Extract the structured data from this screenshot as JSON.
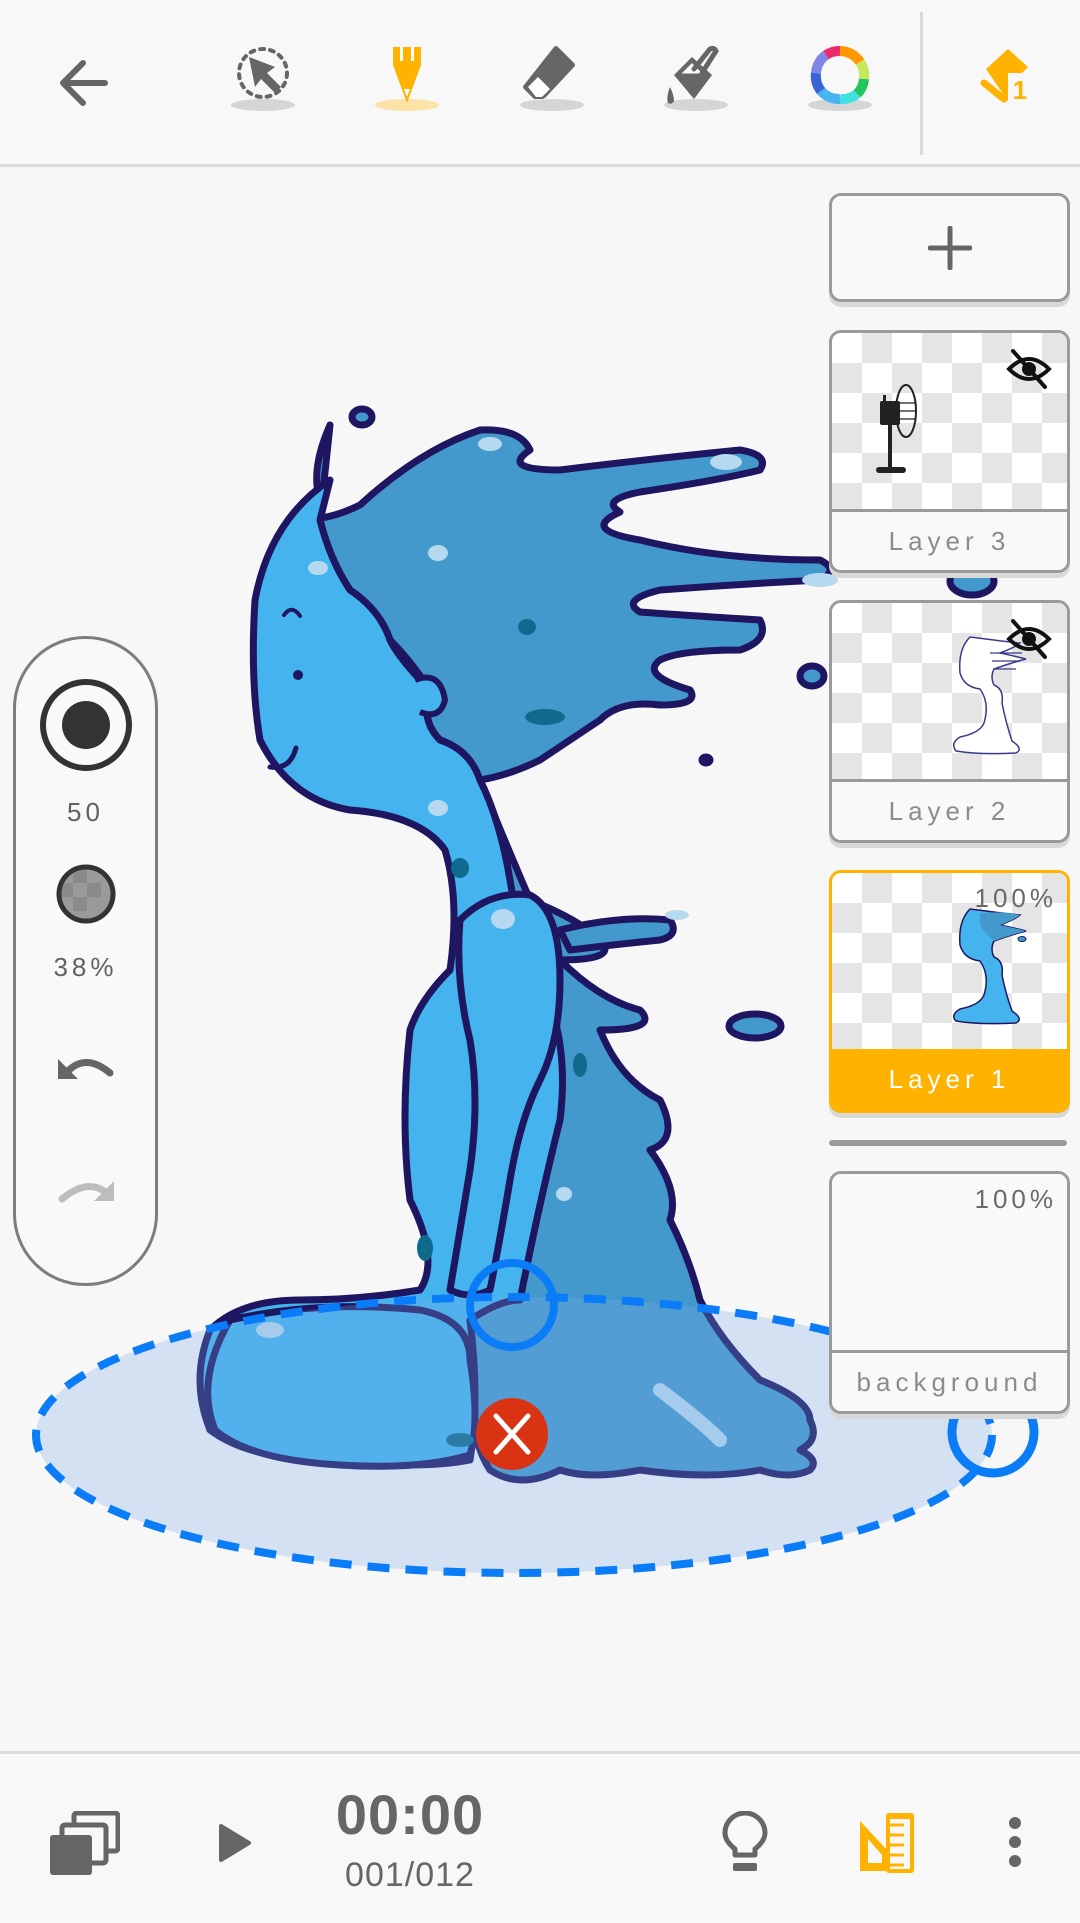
{
  "toolbar": {
    "back": {
      "icon": "arrow-left-icon"
    },
    "tools": [
      {
        "id": "select",
        "icon": "lasso-select-icon",
        "active": false
      },
      {
        "id": "pencil",
        "icon": "pencil-icon",
        "active": true
      },
      {
        "id": "eraser",
        "icon": "eraser-icon",
        "active": false
      },
      {
        "id": "fill",
        "icon": "paint-bucket-icon",
        "active": false
      },
      {
        "id": "color",
        "icon": "color-wheel-icon",
        "active": false
      }
    ],
    "layers_button": {
      "icon": "layers-icon",
      "badge": "1"
    }
  },
  "colors": {
    "accent": "#FFB300",
    "icon_gray": "#666666",
    "ruler_blue": "#0A7CF7",
    "delete_red": "#D93314",
    "figure_light": "#45B4EE",
    "figure_dark": "#4499CC",
    "outline": "#1E1660"
  },
  "side_panel": {
    "brush_size": "50",
    "opacity": "38%",
    "undo": {
      "icon": "undo-icon",
      "enabled": true
    },
    "redo": {
      "icon": "redo-icon",
      "enabled": false
    }
  },
  "layers": {
    "add_label": "+",
    "items": [
      {
        "name": "Layer 3",
        "hidden": true,
        "opacity": "",
        "selected": false,
        "thumb": "fan"
      },
      {
        "name": "Layer 2",
        "hidden": true,
        "opacity": "",
        "selected": false,
        "thumb": "sketch"
      },
      {
        "name": "Layer 1",
        "hidden": false,
        "opacity": "100%",
        "selected": true,
        "thumb": "figure"
      }
    ],
    "background": {
      "name": "background",
      "opacity": "100%"
    }
  },
  "ruler": {
    "type": "ellipse",
    "delete_icon": "close-icon",
    "rotate_handle_icon": "rotate-handle-icon",
    "resize_handle_icon": "resize-handle-icon"
  },
  "bottombar": {
    "frames_icon": "frames-stack-icon",
    "play_icon": "play-icon",
    "time": "00:00",
    "frame_counter": "001/012",
    "onion_skin_icon": "lightbulb-icon",
    "ruler_icon": "ruler-triangle-icon",
    "more_icon": "more-vertical-icon"
  }
}
